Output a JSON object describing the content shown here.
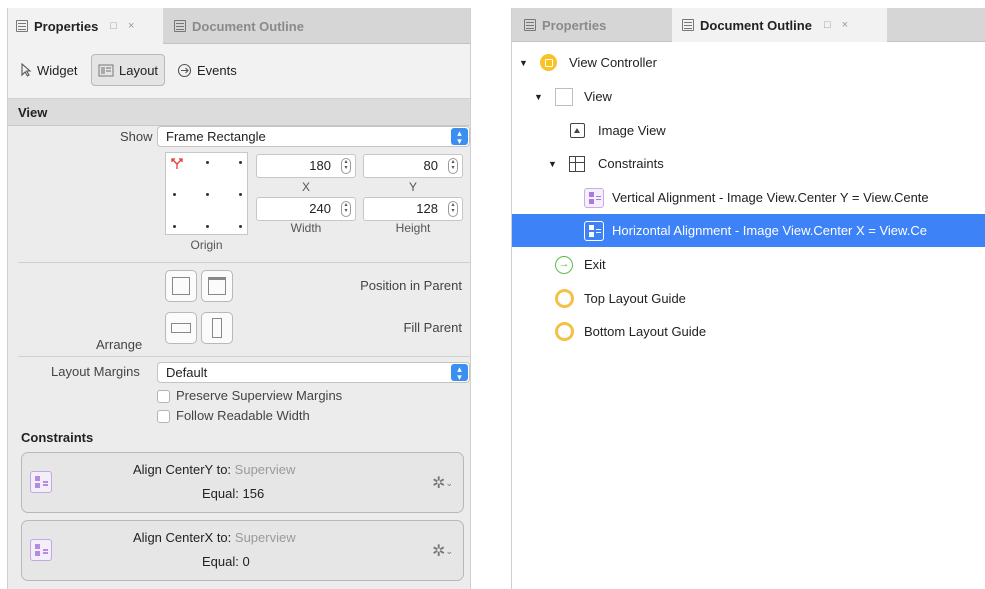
{
  "left": {
    "tabs": [
      {
        "label": "Properties",
        "active": true
      },
      {
        "label": "Document Outline",
        "active": false
      }
    ],
    "modes": [
      {
        "label": "Widget",
        "icon": "pointer-icon",
        "active": false
      },
      {
        "label": "Layout",
        "icon": "layout-icon",
        "active": true
      },
      {
        "label": "Events",
        "icon": "arrow-circle-icon",
        "active": false
      }
    ],
    "view_section": "View",
    "show": {
      "label": "Show",
      "value": "Frame Rectangle"
    },
    "origin_label": "Origin",
    "frame": {
      "x": {
        "value": "180",
        "caption": "X"
      },
      "y": {
        "value": "80",
        "caption": "Y"
      },
      "width": {
        "value": "240",
        "caption": "Width"
      },
      "height": {
        "value": "128",
        "caption": "Height"
      }
    },
    "arrange": {
      "label": "Arrange",
      "position_in_parent": "Position in Parent",
      "fill_parent": "Fill Parent"
    },
    "layout_margins": {
      "label": "Layout Margins",
      "value": "Default"
    },
    "checkboxes": [
      {
        "label": "Preserve Superview Margins",
        "checked": false
      },
      {
        "label": "Follow Readable Width",
        "checked": false
      }
    ],
    "constraints_title": "Constraints",
    "constraints": [
      {
        "prefix": "Align CenterY to:",
        "target": "Superview",
        "equal_label": "Equal:",
        "equal_value": "156"
      },
      {
        "prefix": "Align CenterX to:",
        "target": "Superview",
        "equal_label": "Equal:",
        "equal_value": "0"
      }
    ]
  },
  "right": {
    "tabs": [
      {
        "label": "Properties",
        "active": false
      },
      {
        "label": "Document Outline",
        "active": true
      }
    ],
    "tree": [
      {
        "label": "View Controller",
        "icon": "view-controller-icon",
        "expanded": true,
        "selected": false
      },
      {
        "label": "View",
        "icon": "view-icon",
        "expanded": true,
        "selected": false
      },
      {
        "label": "Image View",
        "icon": "image-view-icon",
        "selected": false
      },
      {
        "label": "Constraints",
        "icon": "constraints-icon",
        "expanded": true,
        "selected": false
      },
      {
        "label": "Vertical Alignment - Image View.Center Y = View.Cente",
        "icon": "constraint-icon",
        "selected": false
      },
      {
        "label": "Horizontal Alignment - Image View.Center X = View.Ce",
        "icon": "constraint-icon",
        "selected": true
      },
      {
        "label": "Exit",
        "icon": "exit-icon",
        "selected": false
      },
      {
        "label": "Top Layout Guide",
        "icon": "layout-guide-icon",
        "selected": false
      },
      {
        "label": "Bottom Layout Guide",
        "icon": "layout-guide-icon",
        "selected": false
      }
    ]
  },
  "colors": {
    "selection": "#3e82f7",
    "popup_accent": "#3b8ff0",
    "view_controller": "#f7c325",
    "constraint": "#a978e0",
    "exit": "#5dbb46",
    "layout_guide": "#f5c04a"
  }
}
